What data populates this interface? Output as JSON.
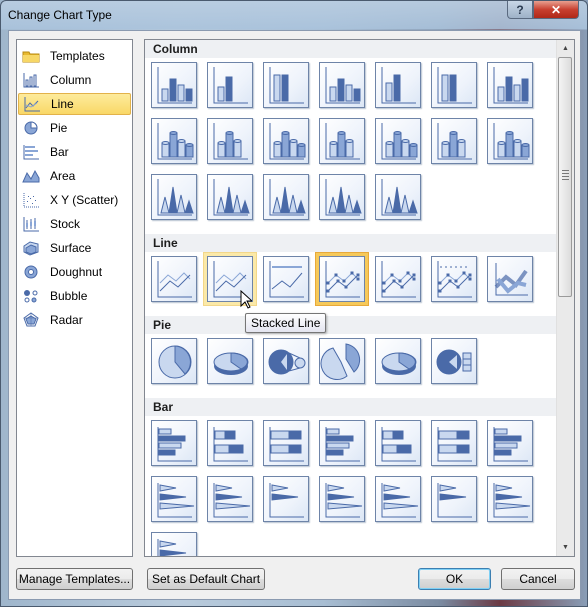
{
  "window": {
    "title": "Change Chart Type",
    "help_icon": "help-icon",
    "close_icon": "close-icon"
  },
  "categories": [
    {
      "label": "Templates",
      "icon": "folder-icon",
      "selected": false
    },
    {
      "label": "Column",
      "icon": "column-chart-icon",
      "selected": false
    },
    {
      "label": "Line",
      "icon": "line-chart-icon",
      "selected": true
    },
    {
      "label": "Pie",
      "icon": "pie-chart-icon",
      "selected": false
    },
    {
      "label": "Bar",
      "icon": "bar-chart-icon",
      "selected": false
    },
    {
      "label": "Area",
      "icon": "area-chart-icon",
      "selected": false
    },
    {
      "label": "X Y (Scatter)",
      "icon": "scatter-chart-icon",
      "selected": false
    },
    {
      "label": "Stock",
      "icon": "stock-chart-icon",
      "selected": false
    },
    {
      "label": "Surface",
      "icon": "surface-chart-icon",
      "selected": false
    },
    {
      "label": "Doughnut",
      "icon": "doughnut-chart-icon",
      "selected": false
    },
    {
      "label": "Bubble",
      "icon": "bubble-chart-icon",
      "selected": false
    },
    {
      "label": "Radar",
      "icon": "radar-chart-icon",
      "selected": false
    }
  ],
  "sections": [
    {
      "title": "Column",
      "count": 19,
      "kind": "column"
    },
    {
      "title": "Line",
      "count": 7,
      "kind": "line"
    },
    {
      "title": "Pie",
      "count": 6,
      "kind": "pie"
    },
    {
      "title": "Bar",
      "count": 15,
      "kind": "bar"
    }
  ],
  "selected_subtype": "Line with Markers",
  "hovered_subtype": "Stacked Line",
  "tooltip": "Stacked Line",
  "buttons": {
    "manage_templates": "Manage Templates...",
    "set_default": "Set as Default Chart",
    "ok": "OK",
    "cancel": "Cancel"
  }
}
